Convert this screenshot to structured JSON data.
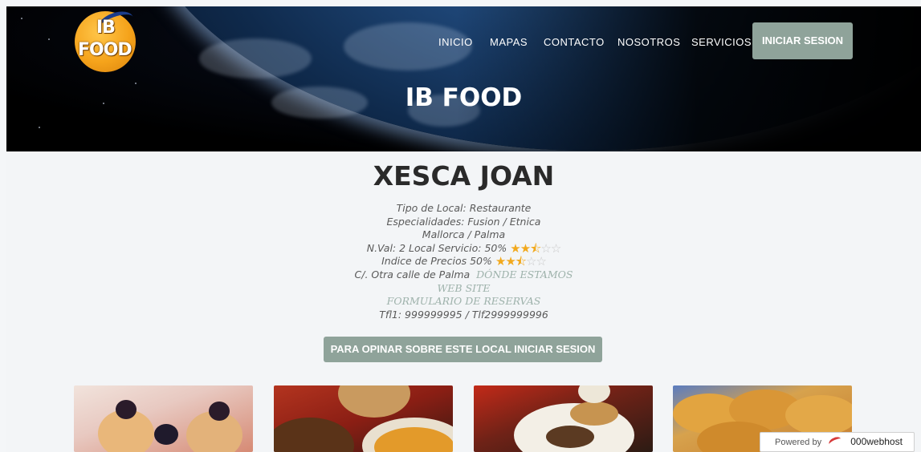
{
  "brand": {
    "logo_line1": "IB",
    "logo_line2": "FOOD"
  },
  "nav": {
    "items": [
      "INICIO",
      "MAPAS",
      "CONTACTO",
      "NOSOTROS",
      "SERVICIOS"
    ],
    "login_label": "INICIAR SESION"
  },
  "hero": {
    "title": "IB FOOD"
  },
  "restaurant": {
    "name": "XESCA JOAN",
    "type": "Tipo de Local: Restaurante",
    "specialties": "Especialidades: Fusion / Etnica",
    "location": "Mallorca / Palma",
    "service_rating_text": "N.Val: 2 Local Servicio: 50%",
    "service_rating_stars": 2.5,
    "price_index_text": "Indice de Precios 50%",
    "price_index_stars": 2.5,
    "address": "C/. Otra calle de Palma",
    "where_link": "DÓNDE ESTAMOS",
    "website_link": "WEB SITE",
    "reservation_link": "FORMULARIO DE RESERVAS",
    "phones": "Tfl1: 999999995 / Tlf2999999996"
  },
  "opinion_button": "PARA OPINAR SOBRE ESTE LOCAL INICIAR SESION",
  "gallery": [
    "dessert-photo",
    "soup-photo",
    "breakfast-photo",
    "empanadas-photo"
  ],
  "hosting_badge": {
    "prefix": "Powered by",
    "brand": "000webhost"
  },
  "colors": {
    "accent": "#8fa39a",
    "star": "#f2a91d",
    "link": "#9eb2ab"
  }
}
